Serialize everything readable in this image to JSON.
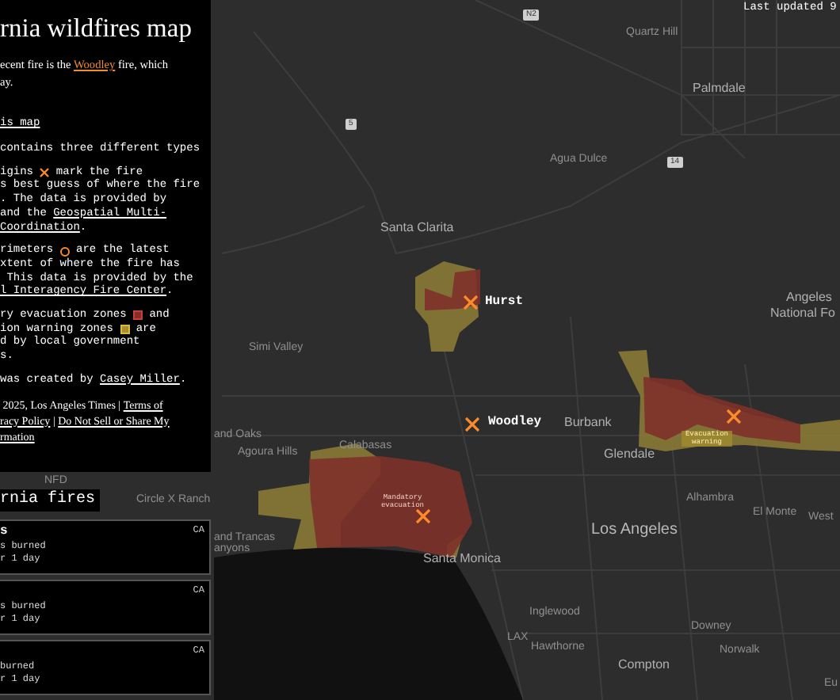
{
  "map": {
    "last_updated": "Last updated 9",
    "shields": [
      "N2",
      "5",
      "14"
    ],
    "labels": [
      {
        "text": "Quartz Hill",
        "kind": "place"
      },
      {
        "text": "Palmdale",
        "kind": "city"
      },
      {
        "text": "Agua Dulce",
        "kind": "place"
      },
      {
        "text": "Santa Clarita",
        "kind": "city"
      },
      {
        "text": "Angeles",
        "kind": "city"
      },
      {
        "text": "National Fo",
        "kind": "city"
      },
      {
        "text": "Hurst",
        "kind": "fire"
      },
      {
        "text": "Simi Valley",
        "kind": "place"
      },
      {
        "text": "Woodley",
        "kind": "fire"
      },
      {
        "text": "Burbank",
        "kind": "city"
      },
      {
        "text": "Glendale",
        "kind": "city"
      },
      {
        "text": "and Oaks",
        "kind": "place"
      },
      {
        "text": "Agoura Hills",
        "kind": "place"
      },
      {
        "text": "Calabasas",
        "kind": "place"
      },
      {
        "text": "and Trancas",
        "kind": "place"
      },
      {
        "text": "anyons",
        "kind": "place"
      },
      {
        "text": "Alhambra",
        "kind": "place"
      },
      {
        "text": "El Monte",
        "kind": "place"
      },
      {
        "text": "West",
        "kind": "place"
      },
      {
        "text": "Los Angeles",
        "kind": "major"
      },
      {
        "text": "Santa Monica",
        "kind": "city"
      },
      {
        "text": "Inglewood",
        "kind": "place"
      },
      {
        "text": "Downey",
        "kind": "place"
      },
      {
        "text": "LAX",
        "kind": "place"
      },
      {
        "text": "Hawthorne",
        "kind": "place"
      },
      {
        "text": "Norwalk",
        "kind": "place"
      },
      {
        "text": "Compton",
        "kind": "city"
      },
      {
        "text": "Eu",
        "kind": "place"
      },
      {
        "text": "NFD",
        "kind": "place"
      },
      {
        "text": "Circle X Ranch",
        "kind": "place"
      }
    ],
    "zone_labels": [
      {
        "text": "Mandatory evacuation",
        "kind": "evacuation"
      },
      {
        "text": "Evacuation warning",
        "kind": "warning"
      }
    ]
  },
  "panel": {
    "title": "rnia wildfires map",
    "intro": [
      "ecent fire is the **Woodley** fire, which",
      "ay."
    ],
    "subhead": "is map",
    "paragraphs": [
      {
        "lines": [
          [
            {
              "kind": "text",
              "text": "contains three different types"
            }
          ]
        ]
      },
      {
        "lines": [
          [
            {
              "kind": "text",
              "text": "igins "
            },
            {
              "kind": "origin_icon"
            },
            {
              "kind": "text",
              "text": " mark the fire"
            }
          ],
          [
            {
              "kind": "text",
              "text": "s best guess of where the fire"
            }
          ],
          [
            {
              "kind": "text",
              "text": ". The data is provided by"
            }
          ],
          [
            {
              "kind": "text",
              "text": "and the "
            },
            {
              "kind": "link",
              "text": "Geospatial Multi-"
            }
          ],
          [
            {
              "kind": "link",
              "text": "Coordination"
            },
            {
              "kind": "text",
              "text": "."
            }
          ]
        ]
      },
      {
        "lines": [
          [
            {
              "kind": "text",
              "text": "rimeters "
            },
            {
              "kind": "perimeter_icon"
            },
            {
              "kind": "text",
              "text": " are the latest"
            }
          ],
          [
            {
              "kind": "text",
              "text": "xtent of where the fire has"
            }
          ],
          [
            {
              "kind": "text",
              "text": " This data is provided by the"
            }
          ],
          [
            {
              "kind": "link",
              "text": "l Interagency Fire Center"
            },
            {
              "kind": "text",
              "text": "."
            }
          ]
        ]
      },
      {
        "lines": [
          [
            {
              "kind": "text",
              "text": "ry evacuation zones "
            },
            {
              "kind": "evacuation_icon"
            },
            {
              "kind": "text",
              "text": " and"
            }
          ],
          [
            {
              "kind": "text",
              "text": "ion warning zones "
            },
            {
              "kind": "warning_icon"
            },
            {
              "kind": "text",
              "text": " are"
            }
          ],
          [
            {
              "kind": "text",
              "text": "d by local government"
            }
          ],
          [
            {
              "kind": "text",
              "text": "s."
            }
          ]
        ]
      },
      {
        "lines": [
          [
            {
              "kind": "text",
              "text": "was created by "
            },
            {
              "kind": "link",
              "text": "Casey Miller"
            },
            {
              "kind": "text",
              "text": "."
            }
          ]
        ]
      }
    ],
    "footer": [
      [
        {
          "kind": "text",
          "text": " 2025, Los Angeles Times | "
        },
        {
          "kind": "link",
          "text": "Terms of"
        }
      ],
      [
        {
          "kind": "link",
          "text": "racy Policy"
        },
        {
          "kind": "text",
          "text": " | "
        },
        {
          "kind": "link",
          "text": "Do Not Sell or Share My"
        }
      ],
      [
        {
          "kind": "link",
          "text": "rmation"
        }
      ]
    ]
  },
  "fires_list": {
    "title": "rnia fires",
    "cards": [
      {
        "name": "s",
        "state": "CA",
        "details": [
          "s burned",
          "r 1 day"
        ]
      },
      {
        "state": "CA",
        "details": [
          "s burned",
          "r 1 day"
        ]
      },
      {
        "state": "CA",
        "details": [
          "burned",
          "r 1 day"
        ]
      }
    ]
  }
}
